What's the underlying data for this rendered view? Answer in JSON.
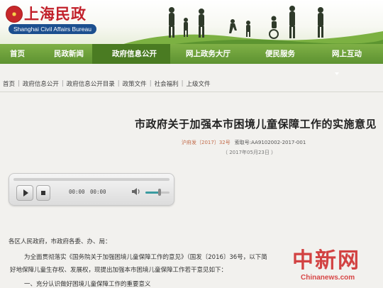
{
  "site": {
    "name_cn": "上海民政",
    "name_en": "Shanghai Civil Affairs Bureau"
  },
  "nav": {
    "items": [
      {
        "label": "首页"
      },
      {
        "label": "民政新闻"
      },
      {
        "label": "政府信息公开"
      },
      {
        "label": "网上政务大厅"
      },
      {
        "label": "便民服务"
      },
      {
        "label": "网上互动"
      }
    ]
  },
  "breadcrumb": {
    "items": [
      "首页",
      "政府信息公开",
      "政府信息公开目录",
      "政策文件",
      "社会福利",
      "上级文件"
    ]
  },
  "article": {
    "title": "市政府关于加强本市困境儿童保障工作的实施意见",
    "doc_no": "沪府发〔2017〕32号",
    "index_no": "索取号:AA9102002-2017-001",
    "date": "（ 2017年05月23日 ）"
  },
  "player": {
    "current_time": "00:00",
    "total_time": "00:00",
    "volume": 0.6
  },
  "body": {
    "p1": "各区人民政府，市政府各委、办、局：",
    "p2": "为全面贯彻落实《国务院关于加强困境儿童保障工作的意见》（国发〔2016〕36号，以下简",
    "p3": "好地保障儿童生存权、发展权，现提出加强本市困境儿童保障工作若干意见如下：",
    "p4": "一、充分认识做好困境儿童保障工作的重要意义"
  },
  "watermark": {
    "cn": "中新网",
    "en": "Chinanews.com"
  },
  "colors": {
    "brand_red": "#c2202a",
    "nav_green": "#6fa33b",
    "badge_blue": "#1c4f8f"
  }
}
